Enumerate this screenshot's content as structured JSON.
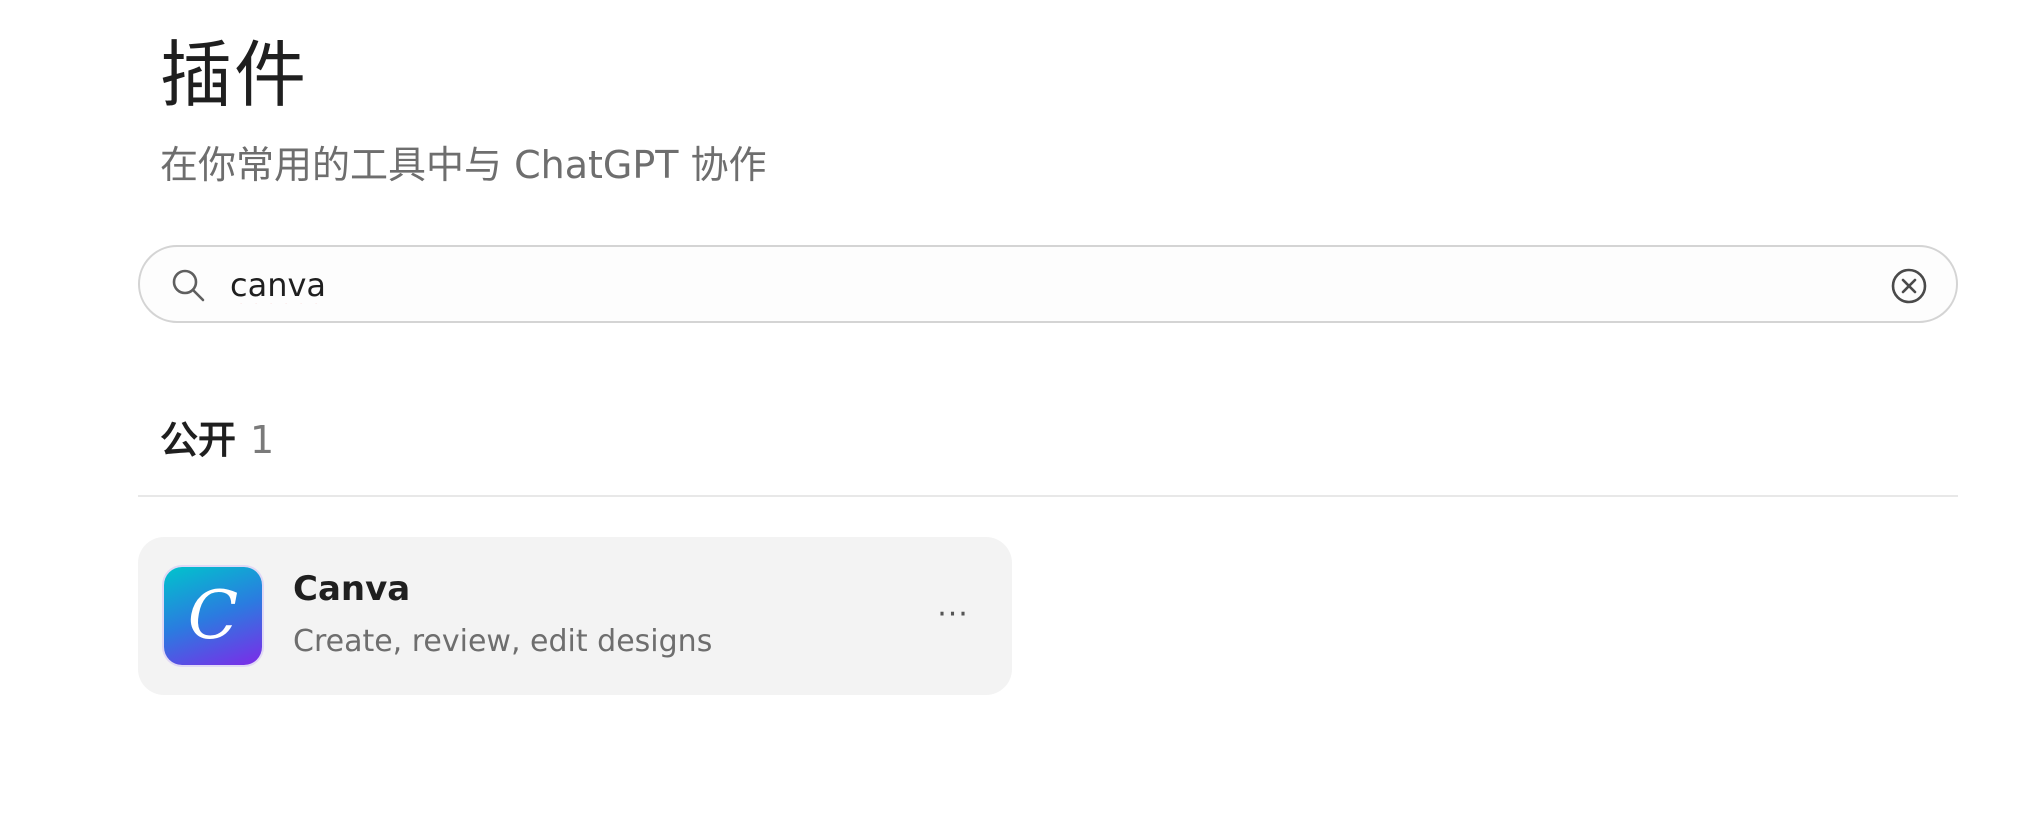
{
  "header": {
    "title": "插件",
    "subtitle": "在你常用的工具中与 ChatGPT 协作"
  },
  "search": {
    "value": "canva",
    "icon": "search-icon",
    "clear_icon": "clear-icon"
  },
  "section": {
    "label": "公开",
    "count": "1"
  },
  "plugins": [
    {
      "name": "Canva",
      "description": "Create, review, edit designs",
      "logo_letter": "C",
      "more_label": "···"
    }
  ],
  "colors": {
    "logo_gradient_start": "#00c4cc",
    "logo_gradient_end": "#7d2ae8",
    "card_background": "#f3f3f3"
  }
}
